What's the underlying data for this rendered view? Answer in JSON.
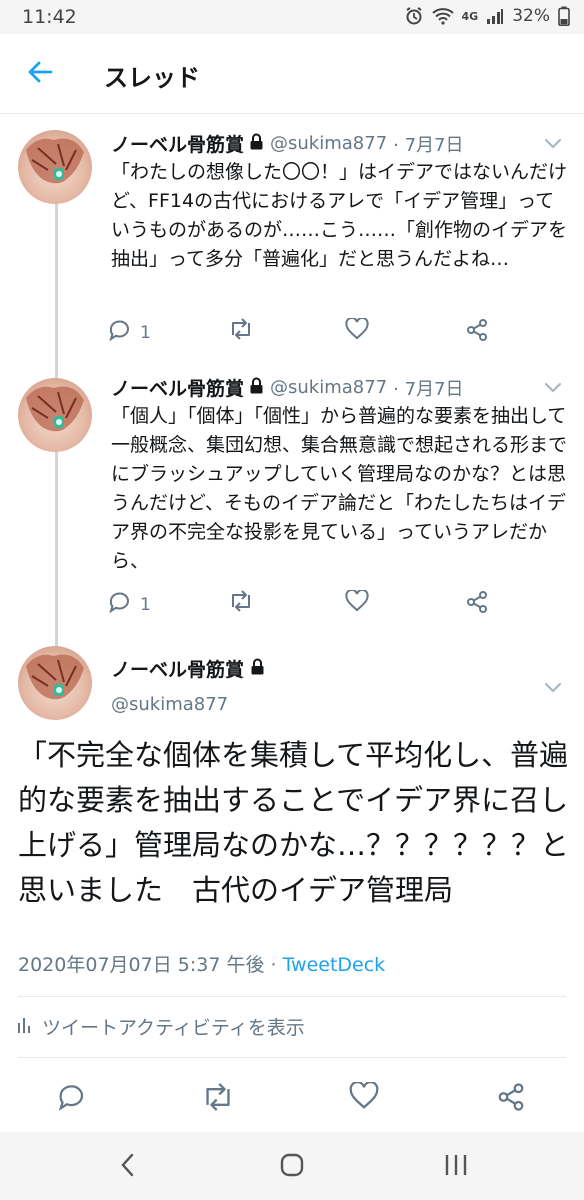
{
  "status_bar": {
    "time": "11:42",
    "network": "4G",
    "battery": "32%"
  },
  "header": {
    "title": "スレッド"
  },
  "tweets": [
    {
      "name": "ノーベル骨筋賞",
      "handle": "@sukima877",
      "date": "· 7月7日",
      "text": "「わたしの想像した〇〇！」はイデアではないんだけど、FF14の古代におけるアレで「イデア管理」っていうものがあるのが……こう……「創作物のイデアを抽出」って多分「普遍化」だと思うんだよね…",
      "reply_count": "1"
    },
    {
      "name": "ノーベル骨筋賞",
      "handle": "@sukima877",
      "date": "· 7月7日",
      "text": "「個人」「個体」「個性」から普遍的な要素を抽出して一般概念、集団幻想、集合無意識で想起される形までにブラッシュアップしていく管理局なのかな？とは思うんだけど、そものイデア論だと「わたしたちはイデア界の不完全な投影を見ている」っていうアレだから、",
      "reply_count": "1"
    }
  ],
  "main_tweet": {
    "name": "ノーベル骨筋賞",
    "handle": "@sukima877",
    "text": "「不完全な個体を集積して平均化し、普遍的な要素を抽出することでイデア界に召し上げる」管理局なのかな…？？？？？？と思いました　古代のイデア管理局",
    "timestamp": "2020年07月07日 5:37 午後 · ",
    "source": "TweetDeck",
    "activity_label": "ツイートアクティビティを表示"
  },
  "colors": {
    "accent": "#1da1f2",
    "text": "#14171a",
    "muted": "#657786",
    "divider": "#e6ecf0"
  },
  "icons": {
    "back": "arrow-left-icon",
    "lock": "lock-icon",
    "reply": "reply-icon",
    "retweet": "retweet-icon",
    "like": "heart-icon",
    "share": "share-icon",
    "chevron": "chevron-down-icon",
    "activity": "bar-chart-icon"
  }
}
